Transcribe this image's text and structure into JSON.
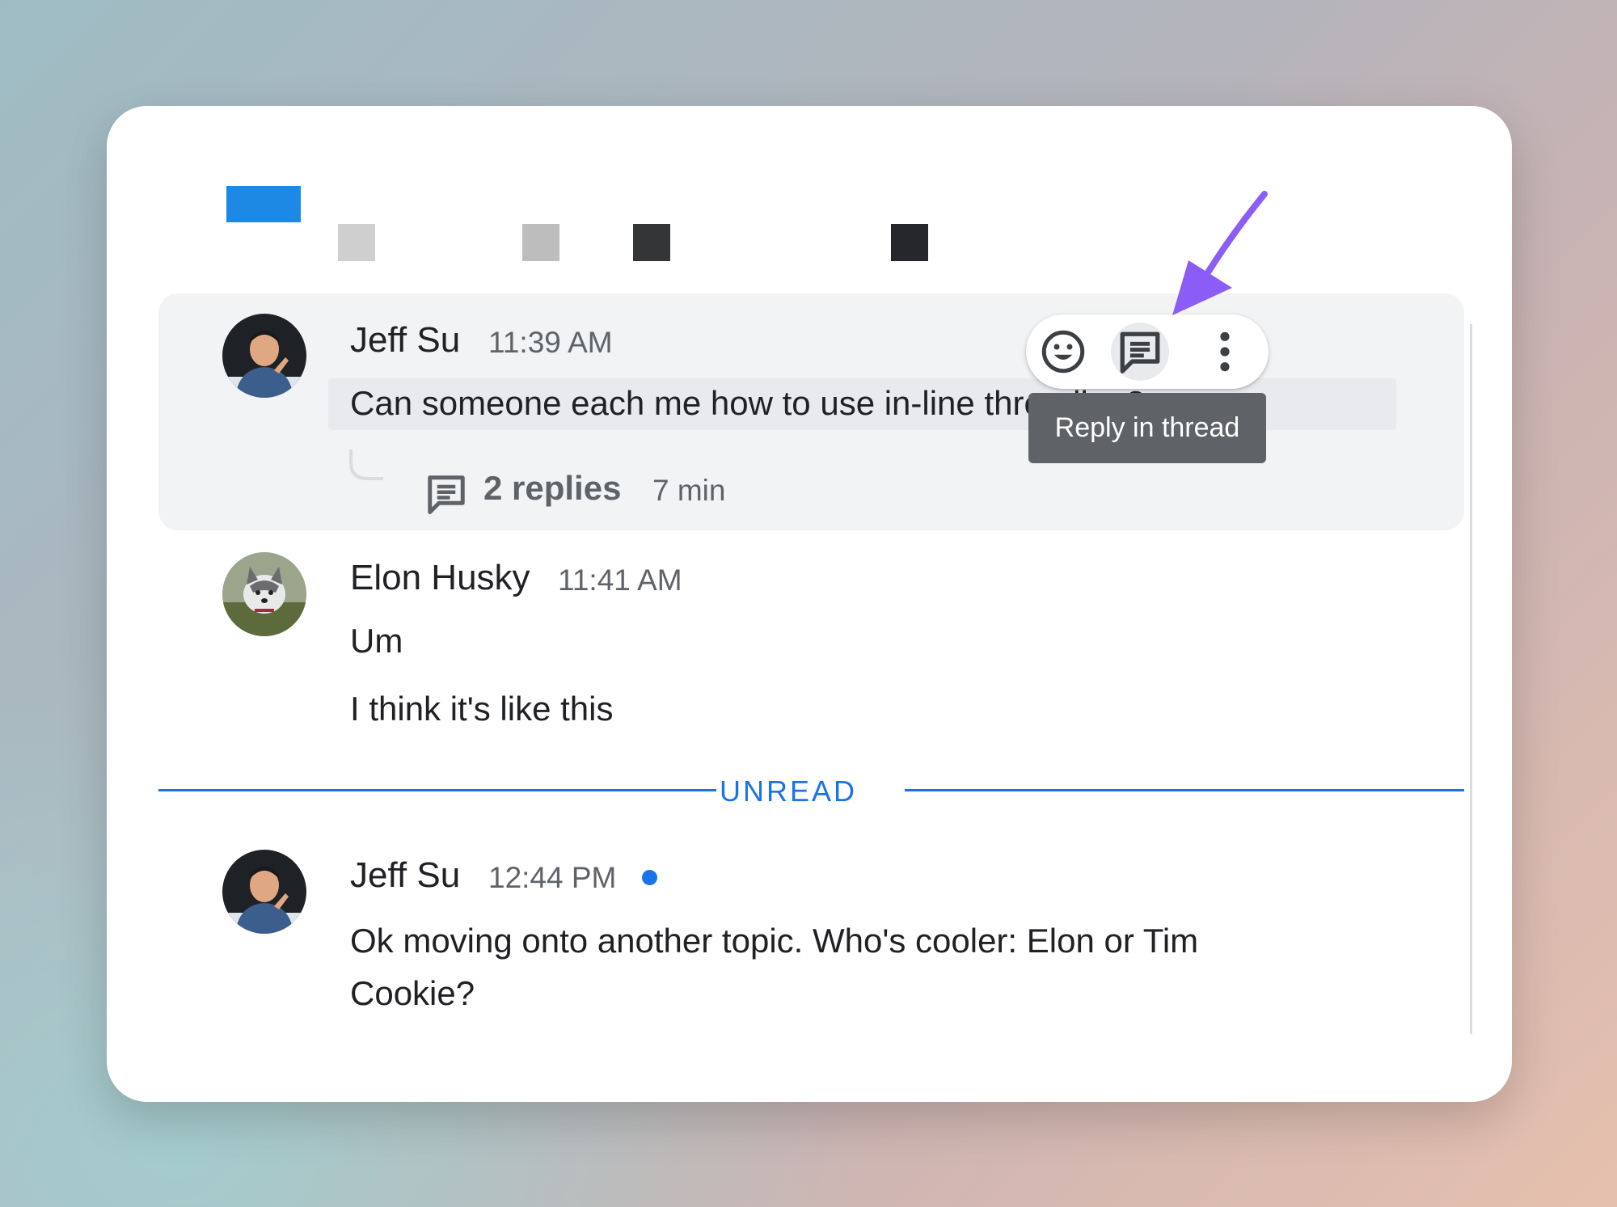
{
  "colors": {
    "accent": "#1a73e8",
    "arrow": "#8b5cf6",
    "hover_bg": "#f1f3f4",
    "tooltip_bg": "#5f6368"
  },
  "messages": [
    {
      "author": "Jeff Su",
      "time": "11:39 AM",
      "lines": [
        "Can someone each me how to use in-line threading?"
      ],
      "thread": {
        "replies": "2 replies",
        "last": "7 min"
      }
    },
    {
      "author": "Elon Husky",
      "time": "11:41 AM",
      "lines": [
        "Um",
        "I think it's like this"
      ]
    },
    {
      "author": "Jeff Su",
      "time": "12:44 PM",
      "lines": [
        "Ok moving onto another topic. Who's cooler: Elon or Tim",
        "Cookie?"
      ]
    }
  ],
  "actions": {
    "emoji_icon": "emoji-smile-icon",
    "thread_icon": "reply-thread-icon",
    "more_icon": "more-vert-icon",
    "tooltip": "Reply in thread"
  },
  "unread_label": "UNREAD"
}
